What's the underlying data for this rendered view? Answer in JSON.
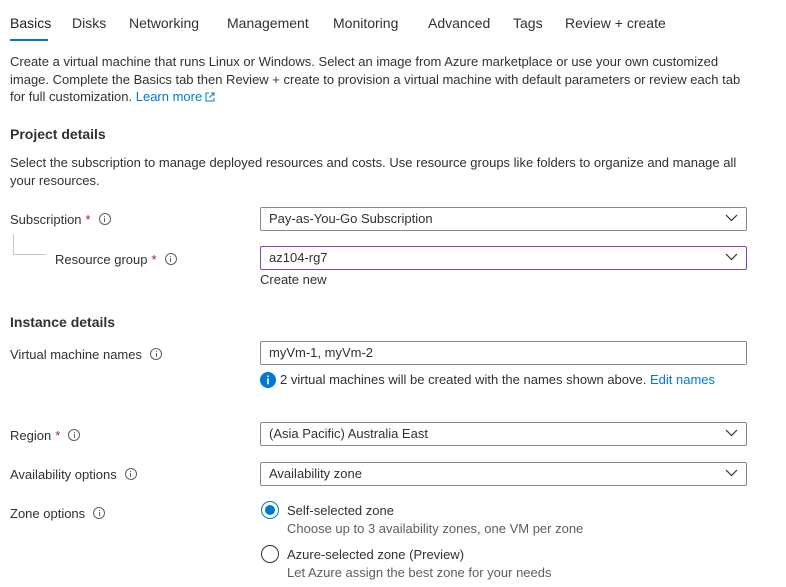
{
  "tabs": [
    {
      "label": "Basics"
    },
    {
      "label": "Disks"
    },
    {
      "label": "Networking"
    },
    {
      "label": "Management"
    },
    {
      "label": "Monitoring"
    },
    {
      "label": "Advanced"
    },
    {
      "label": "Tags"
    },
    {
      "label": "Review + create"
    }
  ],
  "active_tab": "Basics",
  "intro": {
    "text": "Create a virtual machine that runs Linux or Windows. Select an image from Azure marketplace or use your own customized image. Complete the Basics tab then Review + create to provision a virtual machine with default parameters or review each tab for full customization.",
    "link": "Learn more"
  },
  "project": {
    "title": "Project details",
    "desc": "Select the subscription to manage deployed resources and costs. Use resource groups like folders to organize and manage all your resources.",
    "subscription_label": "Subscription",
    "subscription_value": "Pay-as-You-Go Subscription",
    "rg_label": "Resource group",
    "rg_value": "az104-rg7",
    "create_new": "Create new"
  },
  "instance": {
    "title": "Instance details",
    "vm_names_label": "Virtual machine names",
    "vm_names_value": "myVm-1, myVm-2",
    "vm_note": "2 virtual machines will be created with the names shown above.",
    "edit_names": "Edit names",
    "region_label": "Region",
    "region_value": "(Asia Pacific) Australia East",
    "avail_label": "Availability options",
    "avail_value": "Availability zone",
    "zone_label": "Zone options",
    "zone_options": [
      {
        "title": "Self-selected zone",
        "sub": "Choose up to 3 availability zones, one VM per zone",
        "checked": true
      },
      {
        "title": "Azure-selected zone (Preview)",
        "sub": "Let Azure assign the best zone for your needs",
        "checked": false
      }
    ]
  },
  "required_mark": "*",
  "colors": {
    "accent": "#0078d4",
    "required": "#a4262c",
    "focus_border": "#8a3fbf"
  }
}
